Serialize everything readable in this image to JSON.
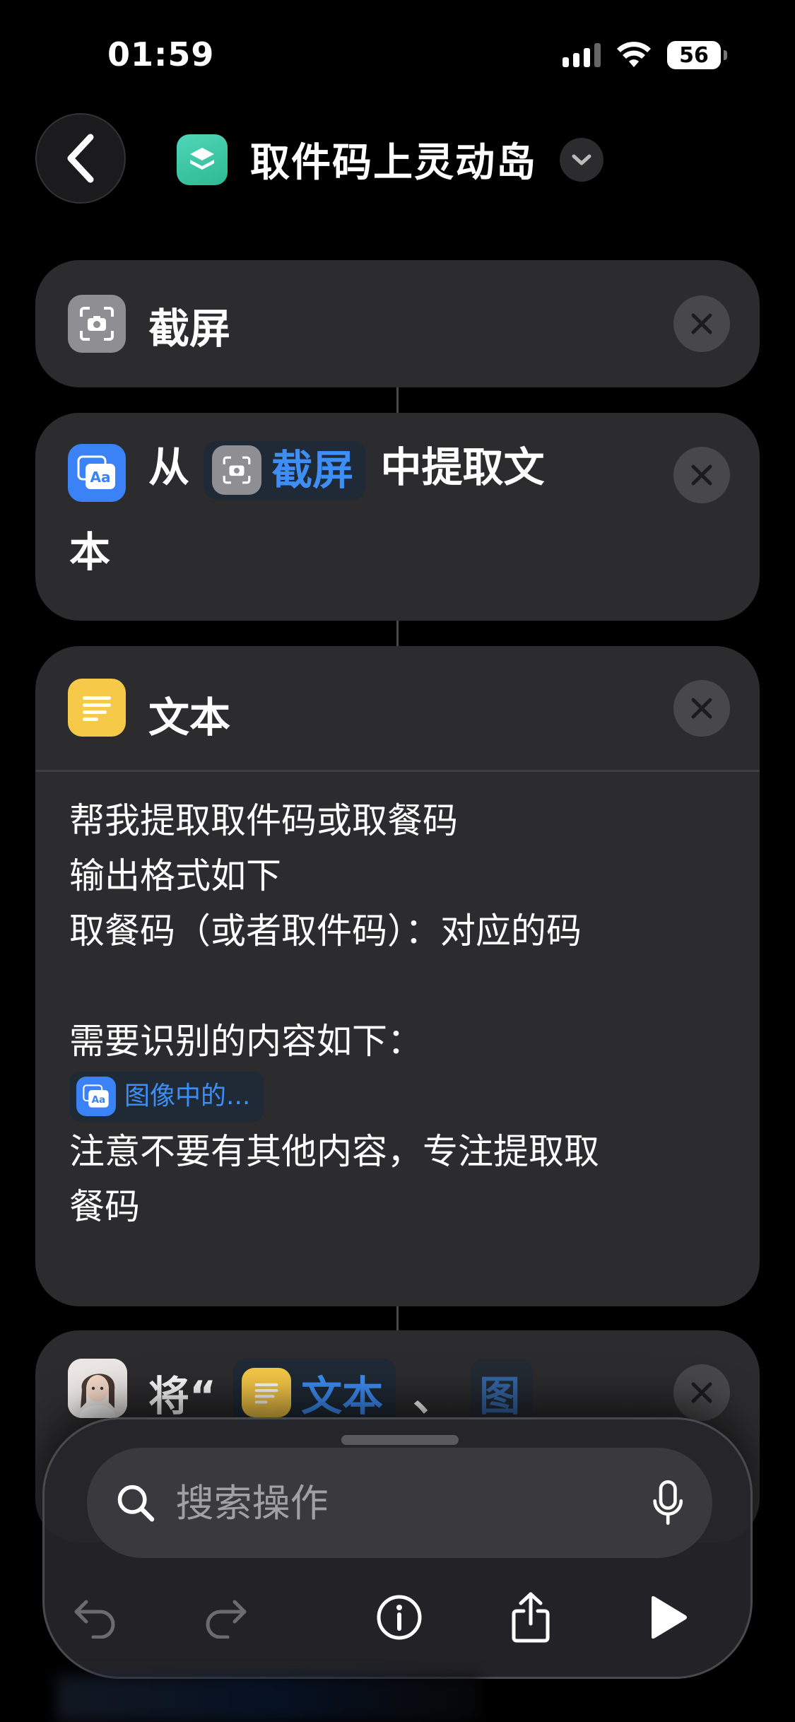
{
  "status_bar": {
    "time": "01:59",
    "battery": "56"
  },
  "header": {
    "title": "取件码上灵动岛"
  },
  "actions": [
    {
      "title": "截屏"
    },
    {
      "prefix": "从",
      "token": "截屏",
      "suffix": "中提取文",
      "suffix2": "本"
    },
    {
      "title": "文本",
      "lines": [
        "帮我提取取件码或取餐码",
        "输出格式如下",
        "取餐码（或者取件码）：对应的码",
        "",
        "需要识别的内容如下："
      ],
      "token": "图像中的...",
      "lines_after": [
        "注意不要有其他内容，专注提取取",
        "餐码"
      ]
    },
    {
      "prefix": "将“",
      "token": "文本",
      "sep": "、",
      "token2": "图"
    }
  ],
  "panel": {
    "search_placeholder": "搜索操作"
  },
  "colors": {
    "accent": "#3e8ef7",
    "card": "#2c2c2e",
    "shortcut_icon": "#3cc8a6",
    "text_icon": "#f7c948"
  }
}
